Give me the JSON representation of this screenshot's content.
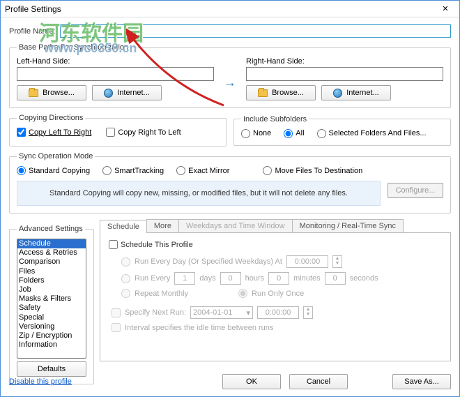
{
  "window": {
    "title": "Profile Settings",
    "close_glyph": "✕"
  },
  "profile": {
    "name_label": "Profile Name:",
    "name_value": ""
  },
  "basepaths": {
    "legend": "Base Paths For Synchronization",
    "left_label": "Left-Hand Side:",
    "right_label": "Right-Hand Side:",
    "left_value": "",
    "right_value": "",
    "browse": "Browse...",
    "internet": "Internet..."
  },
  "copying": {
    "legend": "Copying Directions",
    "ltr": "Copy Left To Right",
    "rtl": "Copy Right To Left"
  },
  "subfolders": {
    "legend": "Include Subfolders",
    "none": "None",
    "all": "All",
    "selected": "Selected Folders And Files..."
  },
  "syncmode": {
    "legend": "Sync Operation Mode",
    "standard": "Standard Copying",
    "smart": "SmartTracking",
    "mirror": "Exact Mirror",
    "move": "Move Files To Destination",
    "desc": "Standard Copying will copy new, missing, or modified files, but it will not delete any files.",
    "configure": "Configure..."
  },
  "advanced": {
    "legend": "Advanced Settings",
    "items": [
      "Schedule",
      "Access & Retries",
      "Comparison",
      "Files",
      "Folders",
      "Job",
      "Masks & Filters",
      "Safety",
      "Special",
      "Versioning",
      "Zip / Encryption",
      "Information"
    ],
    "defaults": "Defaults"
  },
  "tabs": {
    "schedule": "Schedule",
    "more": "More",
    "weekdays": "Weekdays and Time Window",
    "monitoring": "Monitoring / Real-Time Sync"
  },
  "schedule": {
    "enable": "Schedule This Profile",
    "every_day": "Run Every Day (Or Specified Weekdays) At",
    "every_day_time": "0:00:00",
    "run_every": "Run Every",
    "run_every_days_val": "1",
    "days_lbl": "days",
    "hours_val": "0",
    "hours_lbl": "hours",
    "minutes_val": "0",
    "minutes_lbl": "minutes",
    "seconds_val": "0",
    "seconds_lbl": "seconds",
    "repeat_monthly": "Repeat Monthly",
    "run_once": "Run Only Once",
    "specify_next": "Specify Next Run:",
    "next_date": "2004-01-01",
    "next_time": "0:00:00",
    "idle_desc": "Interval specifies the idle time between runs"
  },
  "footer": {
    "disable": "Disable this profile",
    "ok": "OK",
    "cancel": "Cancel",
    "saveas": "Save As..."
  },
  "watermark": {
    "line1": "河东软件园",
    "line2": "www.pc0359.cn"
  }
}
